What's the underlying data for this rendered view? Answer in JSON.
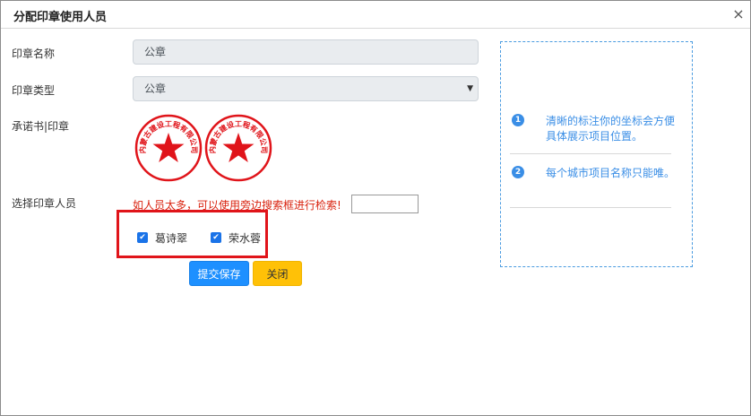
{
  "dialog": {
    "title": "分配印章使用人员",
    "close_symbol": "×"
  },
  "form": {
    "seal_name_label": "印章名称",
    "seal_name_value": "公章",
    "seal_type_label": "印章类型",
    "seal_type_value": "公章",
    "commitment_label": "承诺书|印章",
    "seal_text": "内蒙古建设工程有限公司",
    "select_person_label": "选择印章人员",
    "search_hint": "如人员太多，可以使用旁边搜索框进行检索!",
    "search_value": ""
  },
  "people": [
    {
      "name": "葛诗翠",
      "checked": true
    },
    {
      "name": "荣水蓉",
      "checked": true
    }
  ],
  "buttons": {
    "submit": "提交保存",
    "close": "关闭"
  },
  "help_panel": {
    "steps": [
      {
        "num": "1",
        "text": "清晰的标注你的坐标会方便具体展示项目位置。"
      },
      {
        "num": "2",
        "text": "每个城市项目名称只能唯。"
      }
    ]
  },
  "colors": {
    "primary": "#1e90ff",
    "warning": "#ffc107",
    "seal_red": "#e0141a",
    "hint_red": "#d9230f",
    "panel_blue": "#3a8ee6"
  }
}
